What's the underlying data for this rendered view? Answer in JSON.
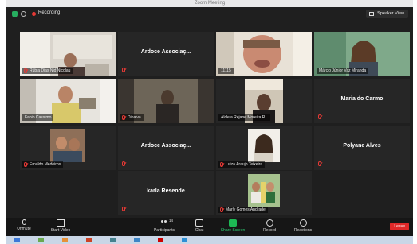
{
  "window": {
    "title": "Zoom Meeting"
  },
  "topbar": {
    "recording_label": "Recording",
    "speaker_view_label": "Speaker View"
  },
  "tiles": [
    {
      "name": "Rúbia Dias Nid Nicolau",
      "type": "video",
      "muted": true
    },
    {
      "name": "Ardoce Associaç...",
      "type": "name",
      "muted": true
    },
    {
      "name": "11115",
      "type": "video",
      "muted": false,
      "active": true
    },
    {
      "name": "Márcio Júnior Vaz Miranda",
      "type": "video",
      "muted": false
    },
    {
      "name": "Fabio Cassimo",
      "type": "video",
      "muted": false
    },
    {
      "name": "Dinalva",
      "type": "video",
      "muted": true
    },
    {
      "name": "Alcleia Rejane Moreira R...",
      "type": "video",
      "muted": false
    },
    {
      "name": "Maria do Carmo",
      "type": "name",
      "muted": true
    },
    {
      "name": "Ernaldo Medeiros",
      "type": "video",
      "muted": true
    },
    {
      "name": "Ardoce Associaç...",
      "type": "name",
      "muted": true
    },
    {
      "name": "Luiza Araujo Teixeira",
      "type": "video",
      "muted": true
    },
    {
      "name": "Polyane Alves",
      "type": "name",
      "muted": true
    },
    {
      "name": "karla Resende",
      "type": "name",
      "muted": true
    },
    {
      "name": "Marly Gomes Andrade",
      "type": "video",
      "muted": true
    }
  ],
  "toolbar": {
    "unmute": "Unmute",
    "start_video": "Start Video",
    "participants": "Participants",
    "participants_count": "14",
    "chat": "Chat",
    "share_screen": "Share Screen",
    "record": "Record",
    "reactions": "Reactions",
    "leave": "Leave"
  },
  "colors": {
    "active_speaker": "#c4cc26",
    "leave": "#e02828",
    "share": "#1db954",
    "muted": "#e53935"
  }
}
